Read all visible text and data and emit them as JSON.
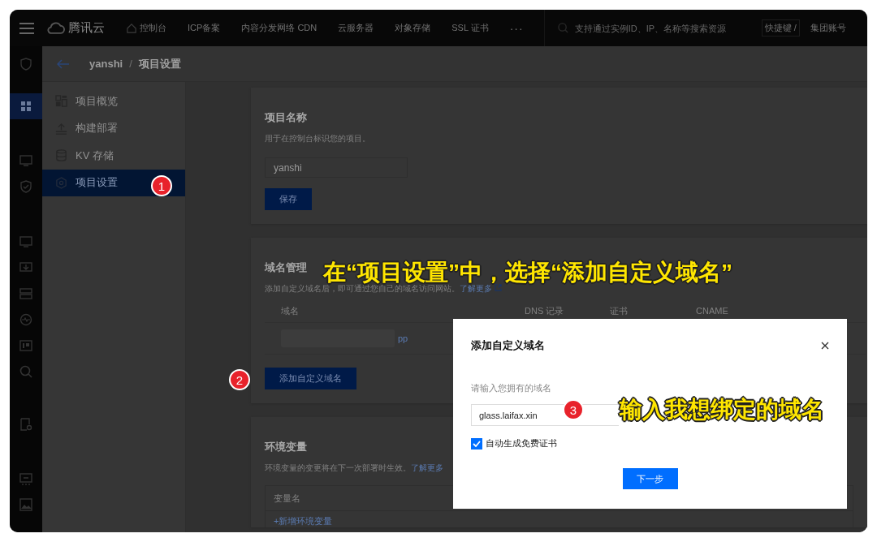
{
  "top_nav": {
    "brand": "腾讯云",
    "items": [
      {
        "label": "控制台",
        "kind": "home"
      },
      {
        "label": "ICP备案",
        "kind": "text"
      },
      {
        "label": "内容分发网络 CDN",
        "kind": "text"
      },
      {
        "label": "云服务器",
        "kind": "text"
      },
      {
        "label": "对象存储",
        "kind": "text"
      },
      {
        "label": "SSL 证书",
        "kind": "text"
      },
      {
        "label": "···",
        "kind": "more"
      }
    ],
    "search": {
      "placeholder": "支持通过实例ID、IP、名称等搜索资源"
    },
    "shortcut": "快捷键 /",
    "account": "集团账号"
  },
  "icon_rail": [
    [
      {
        "kind": "shield",
        "selected": false
      }
    ],
    [
      {
        "kind": "grid",
        "selected": true
      }
    ],
    [
      {
        "kind": "monitor",
        "selected": false
      },
      {
        "kind": "shield-check",
        "selected": false
      }
    ],
    [
      {
        "kind": "monitor",
        "selected": false
      },
      {
        "kind": "download",
        "selected": false
      },
      {
        "kind": "list",
        "selected": false
      },
      {
        "kind": "pulse",
        "selected": false
      },
      {
        "kind": "ip",
        "selected": false
      },
      {
        "kind": "search",
        "selected": false
      }
    ],
    [
      {
        "kind": "doc-gear",
        "selected": false
      }
    ],
    [
      {
        "kind": "chip",
        "selected": false
      },
      {
        "kind": "image",
        "selected": false
      }
    ]
  ],
  "breadcrumb": {
    "project": "yanshi",
    "separator": "/",
    "page": "项目设置"
  },
  "side_menu": [
    {
      "label": "项目概览",
      "kind": "overview",
      "selected": false
    },
    {
      "label": "构建部署",
      "kind": "upload",
      "selected": false
    },
    {
      "label": "KV 存储",
      "kind": "database",
      "selected": false
    },
    {
      "label": "项目设置",
      "kind": "gear",
      "selected": true
    }
  ],
  "project_name_card": {
    "title": "项目名称",
    "description": "用于在控制台标识您的项目。",
    "input_value": "yanshi",
    "button": "保存"
  },
  "domain_card": {
    "title": "域名管理",
    "description": "添加自定义域名后，即可通过您自己的域名访问网站。",
    "link": "了解更多",
    "columns": [
      "域名",
      "DNS 记录",
      "证书",
      "CNAME"
    ],
    "rows": [
      {
        "domain": "pp",
        "redacted": true
      }
    ],
    "button": "添加自定义域名"
  },
  "env_card": {
    "title": "环境变量",
    "description": "环境变量的变更将在下一次部署时生效。",
    "link": "了解更多",
    "columns": [
      "变量名"
    ],
    "add_link": "+新增环境变量"
  },
  "dialog": {
    "title": "添加自定义域名",
    "label": "请输入您拥有的域名",
    "input_value": "glass.laifax.xin",
    "checkbox": {
      "label": "自动生成免费证书",
      "checked": true
    },
    "button": "下一步"
  },
  "annotations": {
    "steps": [
      "1",
      "2",
      "3"
    ],
    "captions": [
      "在“项目设置”中，选择“添加自定义域名”",
      "输入我想绑定的域名"
    ]
  }
}
